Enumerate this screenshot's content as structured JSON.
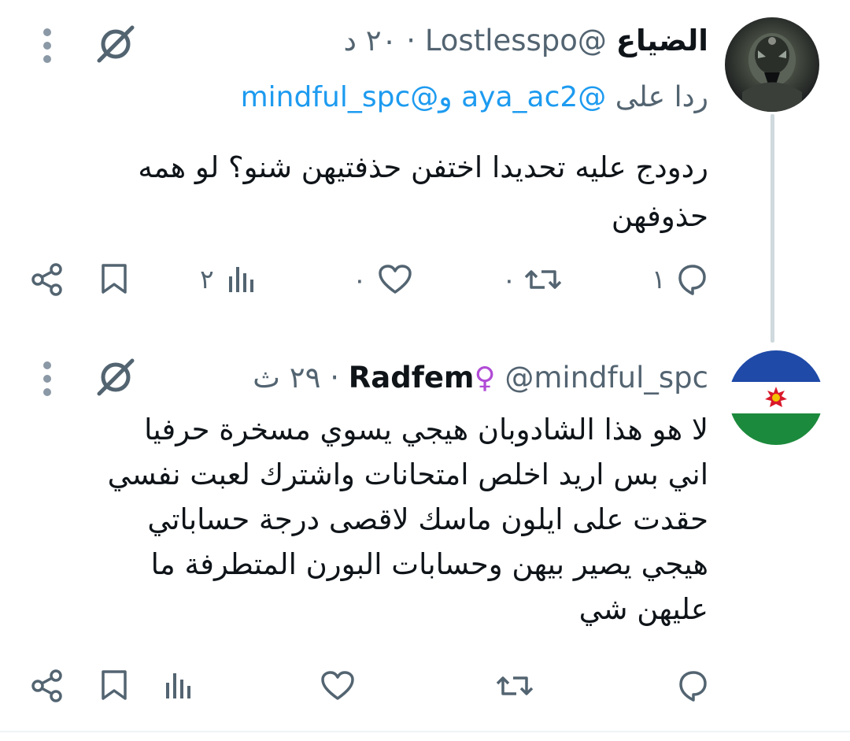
{
  "tweet1": {
    "display_name": "الضياع",
    "handle": "@Lostlesspo",
    "separator": "·",
    "time": "٢٠ د",
    "reply_prefix": "ردا على",
    "mention1": "@aya_ac2",
    "conjunction": "و",
    "mention2": "@mindful_spc",
    "line1": "ردودج عليه تحديدا اختفن حذفتيهن شنو؟ لو همه",
    "line2": "حذوفهن",
    "replies": "١",
    "reposts": "٠",
    "likes": "٠",
    "views": "٢",
    "avatar_icon": "robot-helmet-avatar"
  },
  "tweet2": {
    "display_name": "Radfem",
    "emoji": "♀",
    "handle": "@mindful_spc",
    "separator": "·",
    "time": "٢٩ ث",
    "lines": [
      "لا هو هذا الشادوبان هيجي يسوي مسخرة حرفيا",
      "اني بس اريد اخلص امتحانات واشترك لعبت نفسي",
      "حقدت على ايلون ماسك لاقصى درجة حساباتي",
      "هيجي يصير بيهن وحسابات البورن المتطرفة ما",
      "عليهن شي"
    ],
    "replies": "",
    "reposts": "",
    "likes": "",
    "views": "",
    "avatar_icon": "flag-avatar"
  },
  "colors": {
    "text": "#0f1419",
    "muted": "#536471",
    "link": "#1d9bf0",
    "thread_line": "#cfd9de",
    "emoji_purple": "#b14bd6",
    "flag_blue": "#1f4aa8",
    "flag_white": "#ffffff",
    "flag_green": "#1c8a3c",
    "flag_sun": "#d9182a"
  }
}
